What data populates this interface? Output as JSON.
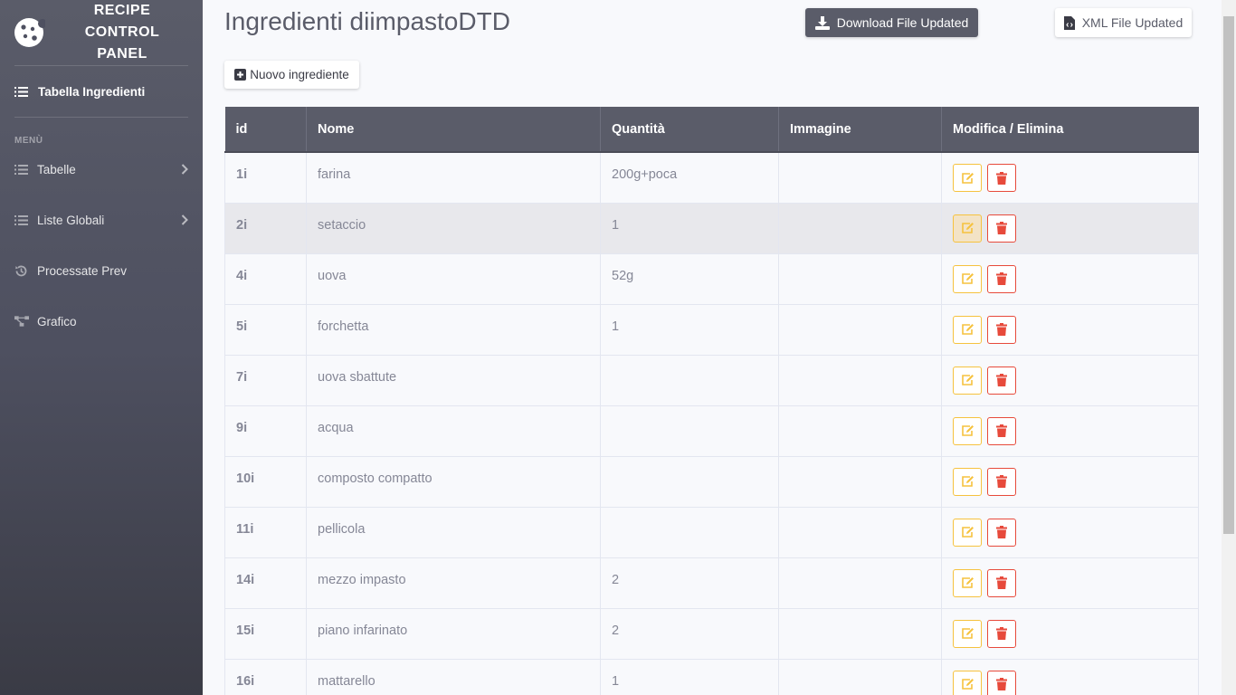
{
  "brand": {
    "line1": "RECIPE",
    "line2": "CONTROL",
    "line3": "PANEL"
  },
  "sidebar": {
    "active": "Tabella Ingredienti",
    "heading": "MENÙ",
    "items": [
      {
        "label": "Tabelle",
        "icon": "list-icon",
        "has_chevron": true
      },
      {
        "label": "Liste Globali",
        "icon": "list-icon",
        "has_chevron": true
      },
      {
        "label": "Processate Prev",
        "icon": "history-icon",
        "has_chevron": false
      },
      {
        "label": "Grafico",
        "icon": "project-diagram-icon",
        "has_chevron": false
      }
    ]
  },
  "header": {
    "title": "Ingredienti diimpastoDTD",
    "download_label": "Download File Updated",
    "xml_label": "XML File Updated",
    "new_label": "Nuovo ingrediente"
  },
  "table": {
    "columns": [
      "id",
      "Nome",
      "Quantità",
      "Immagine",
      "Modifica / Elimina"
    ],
    "rows": [
      {
        "id": "1i",
        "nome": "farina",
        "quantita": "200g+poca",
        "immagine": ""
      },
      {
        "id": "2i",
        "nome": "setaccio",
        "quantita": "1",
        "immagine": ""
      },
      {
        "id": "4i",
        "nome": "uova",
        "quantita": "52g",
        "immagine": ""
      },
      {
        "id": "5i",
        "nome": "forchetta",
        "quantita": "1",
        "immagine": ""
      },
      {
        "id": "7i",
        "nome": "uova sbattute",
        "quantita": "",
        "immagine": ""
      },
      {
        "id": "9i",
        "nome": "acqua",
        "quantita": "",
        "immagine": ""
      },
      {
        "id": "10i",
        "nome": "composto compatto",
        "quantita": "",
        "immagine": ""
      },
      {
        "id": "11i",
        "nome": "pellicola",
        "quantita": "",
        "immagine": ""
      },
      {
        "id": "14i",
        "nome": "mezzo impasto",
        "quantita": "2",
        "immagine": ""
      },
      {
        "id": "15i",
        "nome": "piano infarinato",
        "quantita": "2",
        "immagine": ""
      },
      {
        "id": "16i",
        "nome": "mattarello",
        "quantita": "1",
        "immagine": ""
      }
    ],
    "highlighted_row": 1
  },
  "colors": {
    "sidebar": "#5a5c69",
    "header_bg": "#5a5c69",
    "edit": "#f6c23e",
    "delete": "#e74a3b"
  }
}
